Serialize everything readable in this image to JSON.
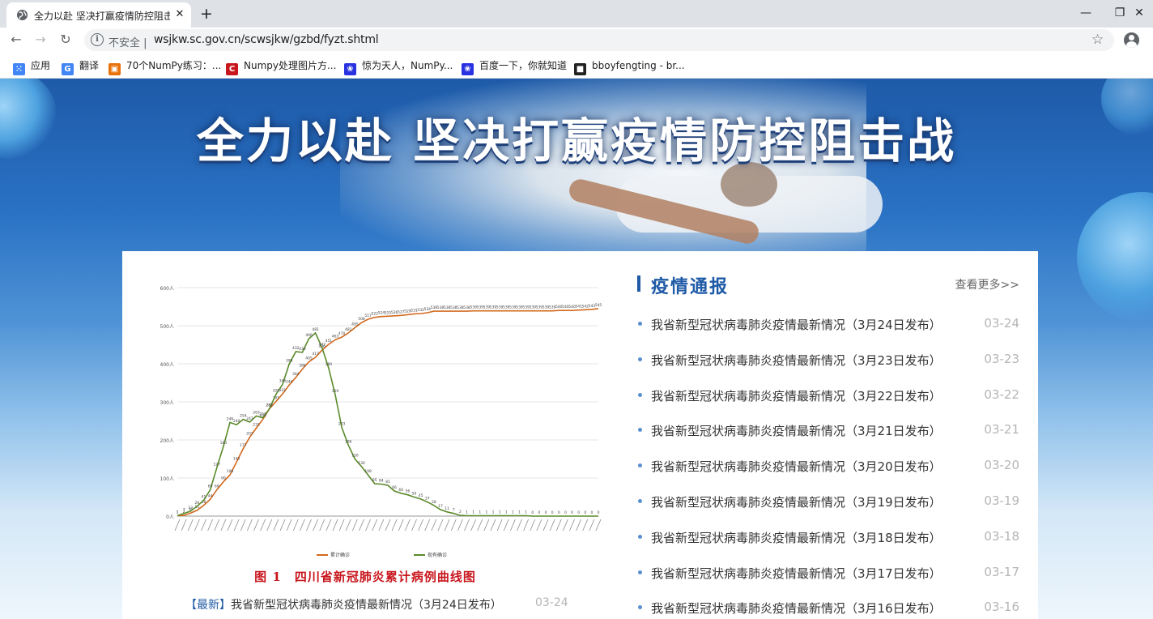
{
  "browser": {
    "tab_title": "全力以赴 坚决打赢疫情防控阻击",
    "tab_close": "✕",
    "new_tab": "+",
    "minimize": "—",
    "restore": "❐",
    "close": "✕",
    "insecure_label": "不安全 |",
    "url": "wsjkw.sc.gov.cn/scwsjkw/gzbd/fyzt.shtml",
    "bookmarks": [
      {
        "label": "应用",
        "icon": "apps-grid-icon",
        "color": "#4285f4"
      },
      {
        "label": "翻译",
        "icon": "translate-icon",
        "color": "#4285f4"
      },
      {
        "label": "70个NumPy练习：...",
        "icon": "photo-icon",
        "color": "#e8710a"
      },
      {
        "label": "Numpy处理图片方...",
        "icon": "csdn-icon",
        "color": "#c8161d"
      },
      {
        "label": "惊为天人，NumPy...",
        "icon": "baidu-paw-icon",
        "color": "#2932e1"
      },
      {
        "label": "百度一下，你就知道",
        "icon": "baidu-paw-icon",
        "color": "#2932e1"
      },
      {
        "label": "bboyfengting - br...",
        "icon": "dark-site-icon",
        "color": "#222222"
      }
    ]
  },
  "banner": {
    "title": "全力以赴 坚决打赢疫情防控阻击战"
  },
  "chart_data": {
    "type": "line",
    "title": "",
    "xlabel": "",
    "ylabel": "",
    "y_ticks": [
      "0人",
      "100人",
      "200人",
      "300人",
      "400人",
      "500人",
      "600人"
    ],
    "ylim": [
      0,
      600
    ],
    "grid": true,
    "legend_position": "bottom",
    "series": [
      {
        "name": "累计确诊",
        "color": "#d2691e",
        "values": [
          1,
          2,
          8,
          15,
          28,
          44,
          69,
          90,
          108,
          142,
          177,
          207,
          231,
          254,
          282,
          301,
          321,
          344,
          364,
          386,
          405,
          417,
          436,
          451,
          463,
          470,
          481,
          495,
          508,
          517,
          522,
          524,
          525,
          526,
          527,
          529,
          531,
          532,
          534,
          538,
          538,
          538,
          538,
          538,
          538,
          539,
          539,
          539,
          539,
          539,
          539,
          539,
          539,
          539,
          539,
          539,
          539,
          539,
          540,
          540,
          540,
          541,
          542,
          543,
          545
        ]
      },
      {
        "name": "现有确诊",
        "color": "#5a8a2a",
        "values": [
          1,
          7,
          13,
          26,
          41,
          69,
          127,
          183,
          246,
          240,
          254,
          247,
          263,
          258,
          282,
          320,
          346,
          399,
          432,
          430,
          466,
          481,
          442,
          389,
          319,
          233,
          186,
          150,
          130,
          108,
          85,
          84,
          81,
          66,
          60,
          56,
          50,
          45,
          37,
          28,
          17,
          11,
          7,
          2,
          1,
          1,
          1,
          1,
          1,
          1,
          1,
          1,
          1,
          1,
          0,
          0,
          0,
          0,
          0,
          0,
          0,
          0,
          0,
          0,
          0
        ]
      }
    ],
    "caption": "图 1　四川省新冠肺炎累计病例曲线图"
  },
  "latest": {
    "tag": "【最新】",
    "text": "我省新型冠状病毒肺炎疫情最新情况（3月24日发布）",
    "date": "03-24"
  },
  "news": {
    "title": "疫情通报",
    "more": "查看更多>>",
    "items": [
      {
        "text": "我省新型冠状病毒肺炎疫情最新情况（3月24日发布）",
        "date": "03-24"
      },
      {
        "text": "我省新型冠状病毒肺炎疫情最新情况（3月23日发布）",
        "date": "03-23"
      },
      {
        "text": "我省新型冠状病毒肺炎疫情最新情况（3月22日发布）",
        "date": "03-22"
      },
      {
        "text": "我省新型冠状病毒肺炎疫情最新情况（3月21日发布）",
        "date": "03-21"
      },
      {
        "text": "我省新型冠状病毒肺炎疫情最新情况（3月20日发布）",
        "date": "03-20"
      },
      {
        "text": "我省新型冠状病毒肺炎疫情最新情况（3月19日发布）",
        "date": "03-19"
      },
      {
        "text": "我省新型冠状病毒肺炎疫情最新情况（3月18日发布）",
        "date": "03-18"
      },
      {
        "text": "我省新型冠状病毒肺炎疫情最新情况（3月17日发布）",
        "date": "03-17"
      },
      {
        "text": "我省新型冠状病毒肺炎疫情最新情况（3月16日发布）",
        "date": "03-16"
      }
    ]
  }
}
